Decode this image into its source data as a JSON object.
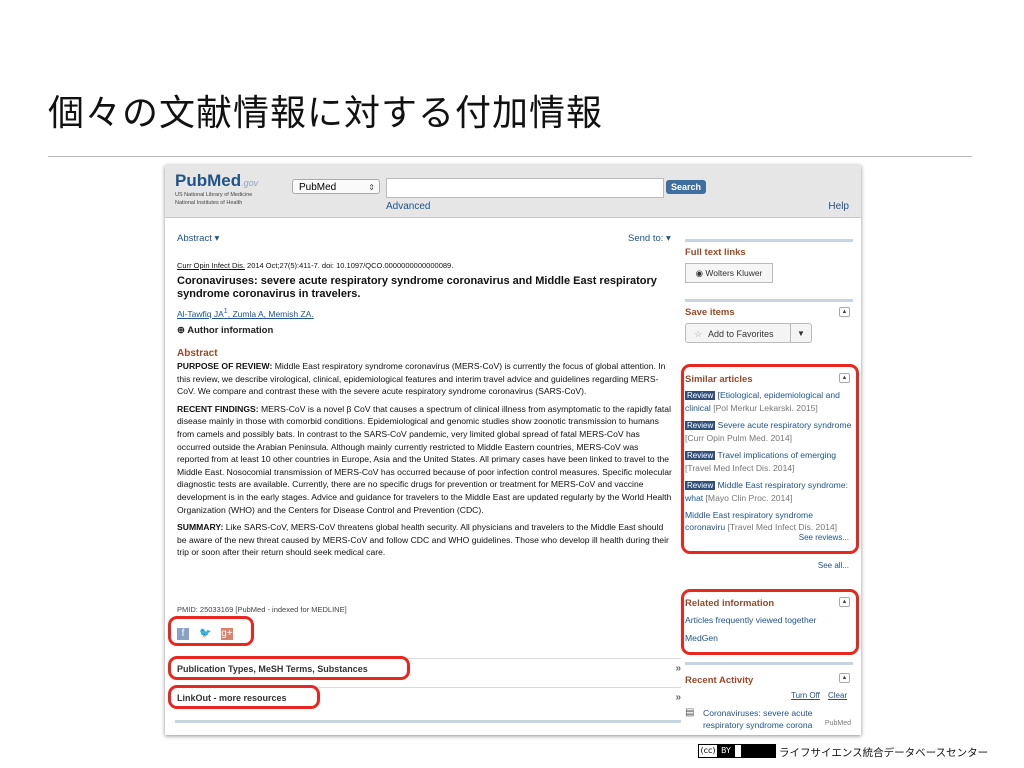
{
  "slide": {
    "title": "個々の文献情報に対する付加情報",
    "credit": "ライフサイエンス統合データベースセンター",
    "license": {
      "cc": "(cc)",
      "by": "BY"
    }
  },
  "pubmed": {
    "logo": {
      "main": "PubMed",
      "gov": ".gov",
      "sub1": "US National Library of Medicine",
      "sub2": "National Institutes of Health"
    },
    "database": "PubMed",
    "search_value": "",
    "search_button": "Search",
    "advanced": "Advanced",
    "help": "Help"
  },
  "article": {
    "format_label": "Abstract ▾",
    "send_to": "Send to: ▾",
    "journal": "Curr Opin Infect Dis.",
    "citation": " 2014 Oct;27(5):411-7. doi: 10.1097/QCO.0000000000000089.",
    "title": "Coronaviruses: severe acute respiratory syndrome coronavirus and Middle East respiratory syndrome coronavirus in travelers.",
    "authors": [
      "Al-Tawfiq JA",
      "Zumla A",
      "Memish ZA"
    ],
    "author_sup": "1",
    "author_info": "Author information",
    "abstract_heading": "Abstract",
    "purpose_label": "PURPOSE OF REVIEW:",
    "purpose_text": " Middle East respiratory syndrome coronavirus (MERS-CoV) is currently the focus of global attention. In this review, we describe virological, clinical, epidemiological features and interim travel advice and guidelines regarding MERS-CoV. We compare and contrast these with the severe acute respiratory syndrome coronavirus (SARS-CoV).",
    "findings_label": "RECENT FINDINGS:",
    "findings_text": " MERS-CoV is a novel β CoV that causes a spectrum of clinical illness from asymptomatic to the rapidly fatal disease mainly in those with comorbid conditions. Epidemiological and genomic studies show zoonotic transmission to humans from camels and possibly bats. In contrast to the SARS-CoV pandemic, very limited global spread of fatal MERS-CoV has occurred outside the Arabian Peninsula. Although mainly currently restricted to Middle Eastern countries, MERS-CoV was reported from at least 10 other countries in Europe, Asia and the United States. All primary cases have been linked to travel to the Middle East. Nosocomial transmission of MERS-CoV has occurred because of poor infection control measures. Specific molecular diagnostic tests are available. Currently, there are no specific drugs for prevention or treatment for MERS-CoV and vaccine development is in the early stages. Advice and guidance for travelers to the Middle East are updated regularly by the World Health Organization (WHO) and the Centers for Disease Control and Prevention (CDC).",
    "summary_label": "SUMMARY:",
    "summary_text": " Like SARS-CoV, MERS-CoV threatens global health security. All physicians and travelers to the Middle East should be aware of the new threat caused by MERS-CoV and follow CDC and WHO guidelines. Those who develop ill health during their trip or soon after their return should seek medical care.",
    "pmid": "PMID: 25033169 [PubMed - indexed for MEDLINE]",
    "sections": [
      "Publication Types, MeSH Terms, Substances",
      "LinkOut - more resources"
    ]
  },
  "sidebar": {
    "full_text_head": "Full text links",
    "full_text_button": "Wolters Kluwer",
    "save_head": "Save items",
    "favorites": "Add to Favorites",
    "similar_head": "Similar articles",
    "similar": [
      {
        "tag": "Review",
        "title": "[Etiological, epidemiological and clinical",
        "src": "[Pol Merkur Lekarski. 2015]"
      },
      {
        "tag": "Review",
        "title": "Severe acute respiratory syndrome",
        "src": "[Curr Opin Pulm Med. 2014]"
      },
      {
        "tag": "Review",
        "title": "Travel implications of emerging",
        "src": "[Travel Med Infect Dis. 2014]"
      },
      {
        "tag": "Review",
        "title": "Middle East respiratory syndrome: what",
        "src": "[Mayo Clin Proc. 2014]"
      },
      {
        "tag": "",
        "title": "Middle East respiratory syndrome coronaviru",
        "src": "[Travel Med Infect Dis. 2014]"
      }
    ],
    "see_reviews": "See reviews...",
    "see_all": "See all...",
    "related_head": "Related information",
    "related": [
      "Articles frequently viewed together",
      "MedGen"
    ],
    "recent_head": "Recent Activity",
    "turn_off": "Turn Off",
    "clear": "Clear",
    "recent_item": "Coronaviruses: severe acute respiratory syndrome corona",
    "recent_src": "PubMed"
  }
}
